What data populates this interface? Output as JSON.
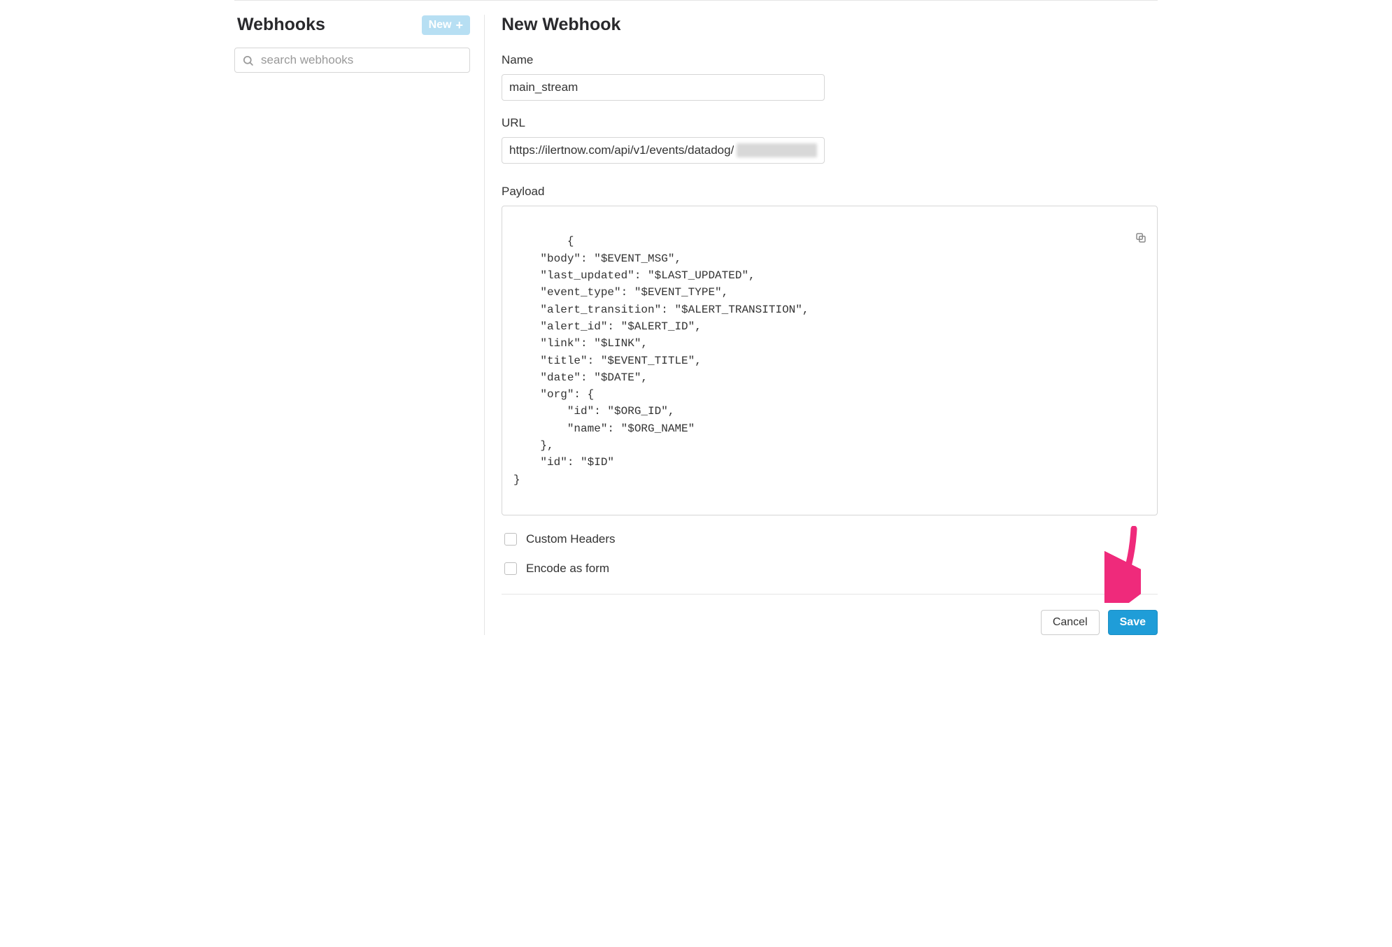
{
  "sidebar": {
    "title": "Webhooks",
    "new_label": "New",
    "search_placeholder": "search webhooks"
  },
  "form": {
    "title": "New Webhook",
    "name_label": "Name",
    "name_value": "main_stream",
    "url_label": "URL",
    "url_value": "https://ilertnow.com/api/v1/events/datadog/",
    "payload_label": "Payload",
    "payload_value": "{\n    \"body\": \"$EVENT_MSG\",\n    \"last_updated\": \"$LAST_UPDATED\",\n    \"event_type\": \"$EVENT_TYPE\",\n    \"alert_transition\": \"$ALERT_TRANSITION\",\n    \"alert_id\": \"$ALERT_ID\",\n    \"link\": \"$LINK\",\n    \"title\": \"$EVENT_TITLE\",\n    \"date\": \"$DATE\",\n    \"org\": {\n        \"id\": \"$ORG_ID\",\n        \"name\": \"$ORG_NAME\"\n    },\n    \"id\": \"$ID\"\n}",
    "custom_headers_label": "Custom Headers",
    "encode_form_label": "Encode as form",
    "cancel_label": "Cancel",
    "save_label": "Save"
  },
  "colors": {
    "save_button": "#1f9dd8",
    "new_button": "#b7dff3",
    "arrow": "#ef2a7b"
  }
}
